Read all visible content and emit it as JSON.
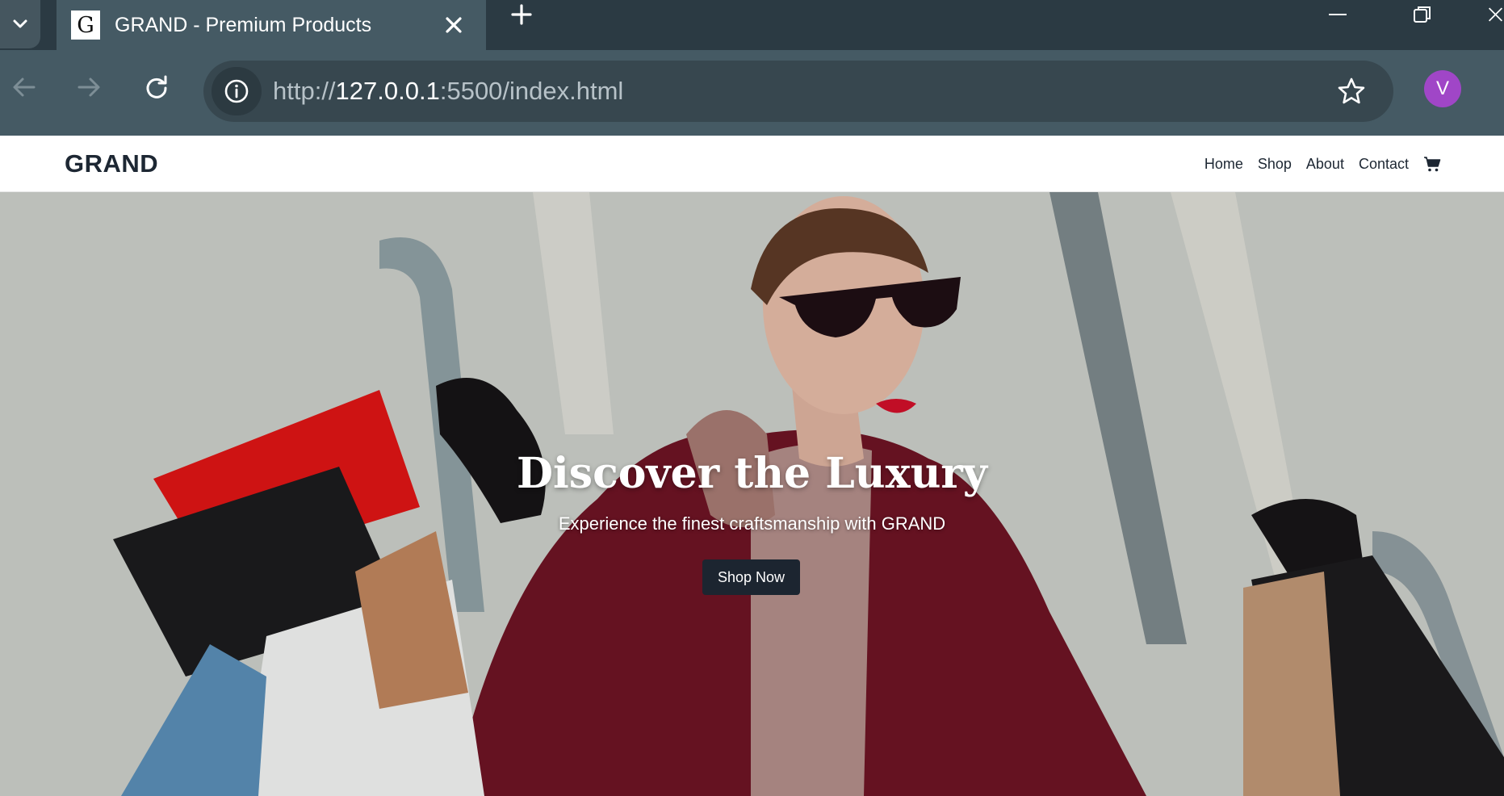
{
  "browser": {
    "tab": {
      "favicon_letter": "G",
      "title": "GRAND - Premium Products"
    },
    "url": {
      "scheme": "http://",
      "host": "127.0.0.1",
      "rest": ":5500/index.html"
    },
    "profile_initial": "V",
    "colors": {
      "tabstrip": "#2b3a43",
      "toolbar": "#455a64",
      "omnibox": "#37474f",
      "avatar": "#a046c7"
    }
  },
  "site": {
    "brand": "GRAND",
    "nav": [
      {
        "label": "Home"
      },
      {
        "label": "Shop"
      },
      {
        "label": "About"
      },
      {
        "label": "Contact"
      }
    ],
    "cart_icon": "cart-icon",
    "hero": {
      "title": "Discover the Luxury",
      "subtitle": "Experience the finest craftsmanship with GRAND",
      "cta": "Shop Now",
      "cta_color": "#1c2530"
    }
  }
}
